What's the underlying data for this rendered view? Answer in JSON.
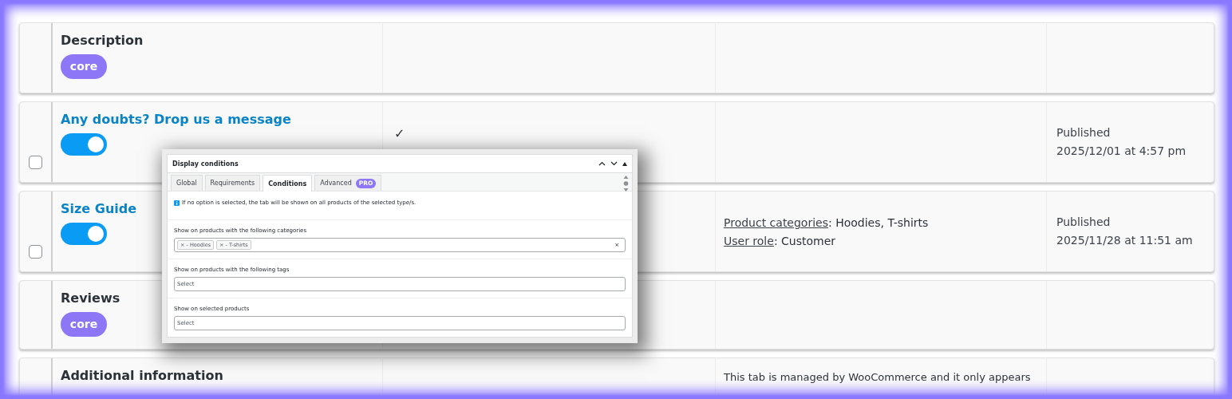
{
  "rows": [
    {
      "title": "Description",
      "link": false,
      "control": {
        "kind": "badge",
        "label": "core"
      }
    },
    {
      "title": "Any doubts? Drop us a message",
      "link": true,
      "checkbox": {
        "checked": false
      },
      "control": {
        "kind": "toggle",
        "on": true
      },
      "column_3": "✓",
      "status": "Published",
      "date": "2025/12/01 at 4:57 pm"
    },
    {
      "title": "Size Guide",
      "link": true,
      "checkbox": {
        "checked": false
      },
      "control": {
        "kind": "toggle",
        "on": true
      },
      "conditions": [
        {
          "label": "Product categories",
          "value": ": Hoodies, T-shirts"
        },
        {
          "label": "User role",
          "value": ": Customer"
        }
      ],
      "status": "Published",
      "date": "2025/11/28 at 11:51 am"
    },
    {
      "title": "Reviews",
      "link": false,
      "control": {
        "kind": "badge",
        "label": "core"
      }
    },
    {
      "title": "Additional information",
      "link": false,
      "note": "This tab is managed by WooCommerce and it only appears"
    }
  ],
  "panel": {
    "title": "Display conditions",
    "tabs": [
      {
        "label": "Global",
        "selected": false
      },
      {
        "label": "Requirements",
        "selected": false
      },
      {
        "label": "Conditions",
        "selected": true
      },
      {
        "label": "Advanced",
        "badge": "PRO",
        "selected": false
      }
    ],
    "notice": "If no option is selected, the tab will be shown on all products of the selected type/s.",
    "fields": [
      {
        "label": "Show on products with the following categories",
        "tags": [
          "× - Hoodies",
          "× - T-shirts"
        ],
        "clear": "×"
      },
      {
        "label": "Show on products with the following tags",
        "placeholder": "Select"
      },
      {
        "label": "Show on selected products",
        "placeholder": "Select"
      }
    ]
  }
}
